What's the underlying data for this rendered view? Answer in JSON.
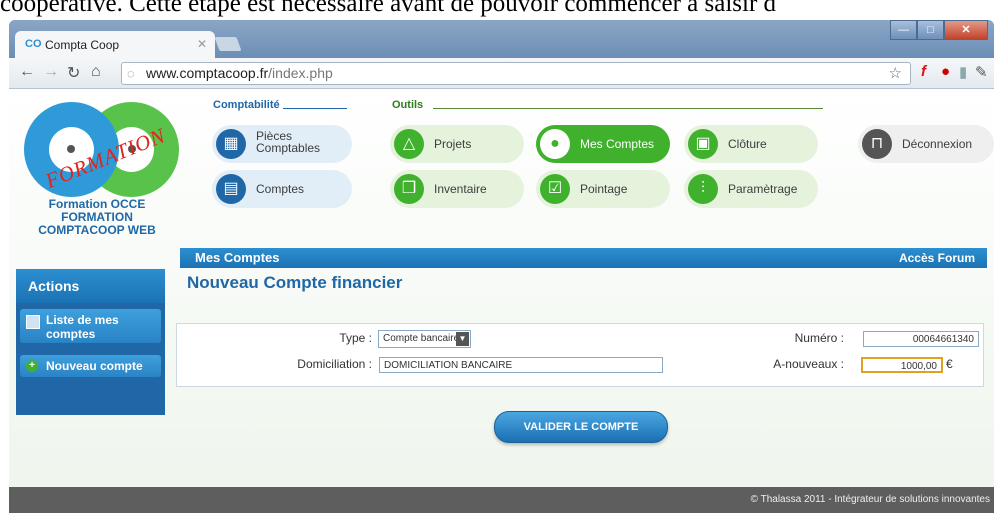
{
  "document": {
    "top_text": "coopérative. Cette étape est nécessaire avant de pouvoir commencer à saisir d"
  },
  "browser": {
    "tab_title": "Compta Coop",
    "tab_logo": "CO",
    "url_host": "www.comptacoop.fr",
    "url_path": "/index.php",
    "window_buttons": {
      "min": "—",
      "max": "□",
      "close": "✕"
    }
  },
  "brand": {
    "stamp": "FORMATION",
    "lines": [
      "Formation OCCE",
      "FORMATION",
      "COMPTACOOP WEB"
    ]
  },
  "sections": {
    "comptabilite": "Comptabilité",
    "outils": "Outils"
  },
  "tools": {
    "pieces": "Pièces Comptables",
    "comptes": "Comptes",
    "projets": "Projets",
    "inventaire": "Inventaire",
    "mes_comptes": "Mes Comptes",
    "pointage": "Pointage",
    "cloture": "Clôture",
    "parametrage": "Paramètrage",
    "deconnexion": "Déconnexion"
  },
  "mainbar": {
    "title": "Mes Comptes",
    "forum": "Accès Forum"
  },
  "sidebar": {
    "title": "Actions",
    "items": [
      "Liste de mes comptes",
      "Nouveau compte"
    ]
  },
  "page": {
    "heading": "Nouveau Compte financier"
  },
  "form": {
    "type_label": "Type :",
    "type_value": "Compte bancaire",
    "numero_label": "Numéro :",
    "numero_value": "00064661340",
    "domiciliation_label": "Domiciliation :",
    "domiciliation_value": "DOMICILIATION BANCAIRE",
    "anouveaux_label": "A-nouveaux :",
    "anouveaux_value": "1000,00",
    "currency": "€"
  },
  "submit_label": "VALIDER LE COMPTE",
  "footer": "© Thalassa 2011 - Intégrateur de solutions innovantes"
}
